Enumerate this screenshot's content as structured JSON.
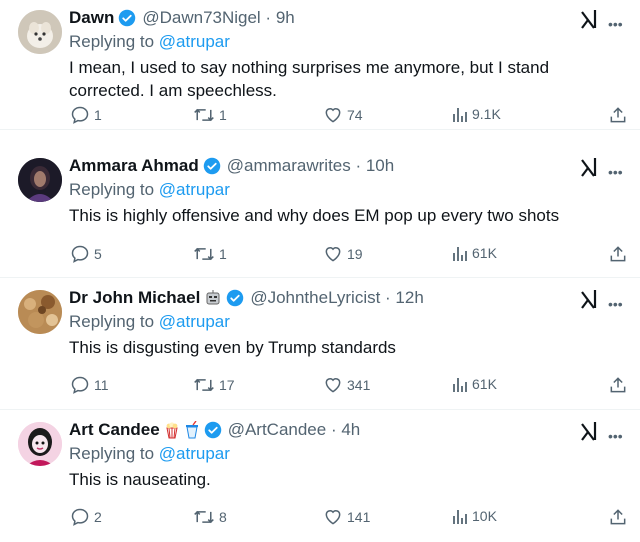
{
  "tweets": [
    {
      "name": "Dawn",
      "handle": "@Dawn73Nigel · 9h",
      "emoji": "",
      "replying_prefix": "Replying to",
      "replying_to": "@atrupar",
      "text": "I mean, I used to say nothing surprises me anymore, but I stand corrected.  I am speechless.",
      "replies": "1",
      "retweets": "1",
      "likes": "74",
      "views": "9.1K"
    },
    {
      "name": "Ammara Ahmad",
      "handle": "@ammarawrites · 10h",
      "emoji": "",
      "replying_prefix": "Replying to",
      "replying_to": "@atrupar",
      "text": "This is highly offensive and why does EM pop up every two shots",
      "replies": "5",
      "retweets": "1",
      "likes": "19",
      "views": "61K"
    },
    {
      "name": "Dr John Michael",
      "handle": "@JohntheLyricist · 12h",
      "emoji": "robot-face",
      "replying_prefix": "Replying to",
      "replying_to": "@atrupar",
      "text": "This is disgusting even by Trump standards",
      "replies": "11",
      "retweets": "17",
      "likes": "341",
      "views": "61K"
    },
    {
      "name": "Art Candee",
      "handle": "@ArtCandee · 4h",
      "emoji": "popcorn-and-drink",
      "replying_prefix": "Replying to",
      "replying_to": "@atrupar",
      "text": "This is nauseating.",
      "replies": "2",
      "retweets": "8",
      "likes": "141",
      "views": "10K"
    }
  ],
  "icons": {
    "more": "more-icon",
    "grok": "grok-icon",
    "reply": "reply-icon",
    "retweet": "retweet-icon",
    "like": "like-icon",
    "views": "views-icon",
    "share": "share-icon"
  },
  "colors": {
    "link": "#1d9bf0",
    "muted": "#536471",
    "verified": "#1d9bf0",
    "text": "#0f1419"
  }
}
